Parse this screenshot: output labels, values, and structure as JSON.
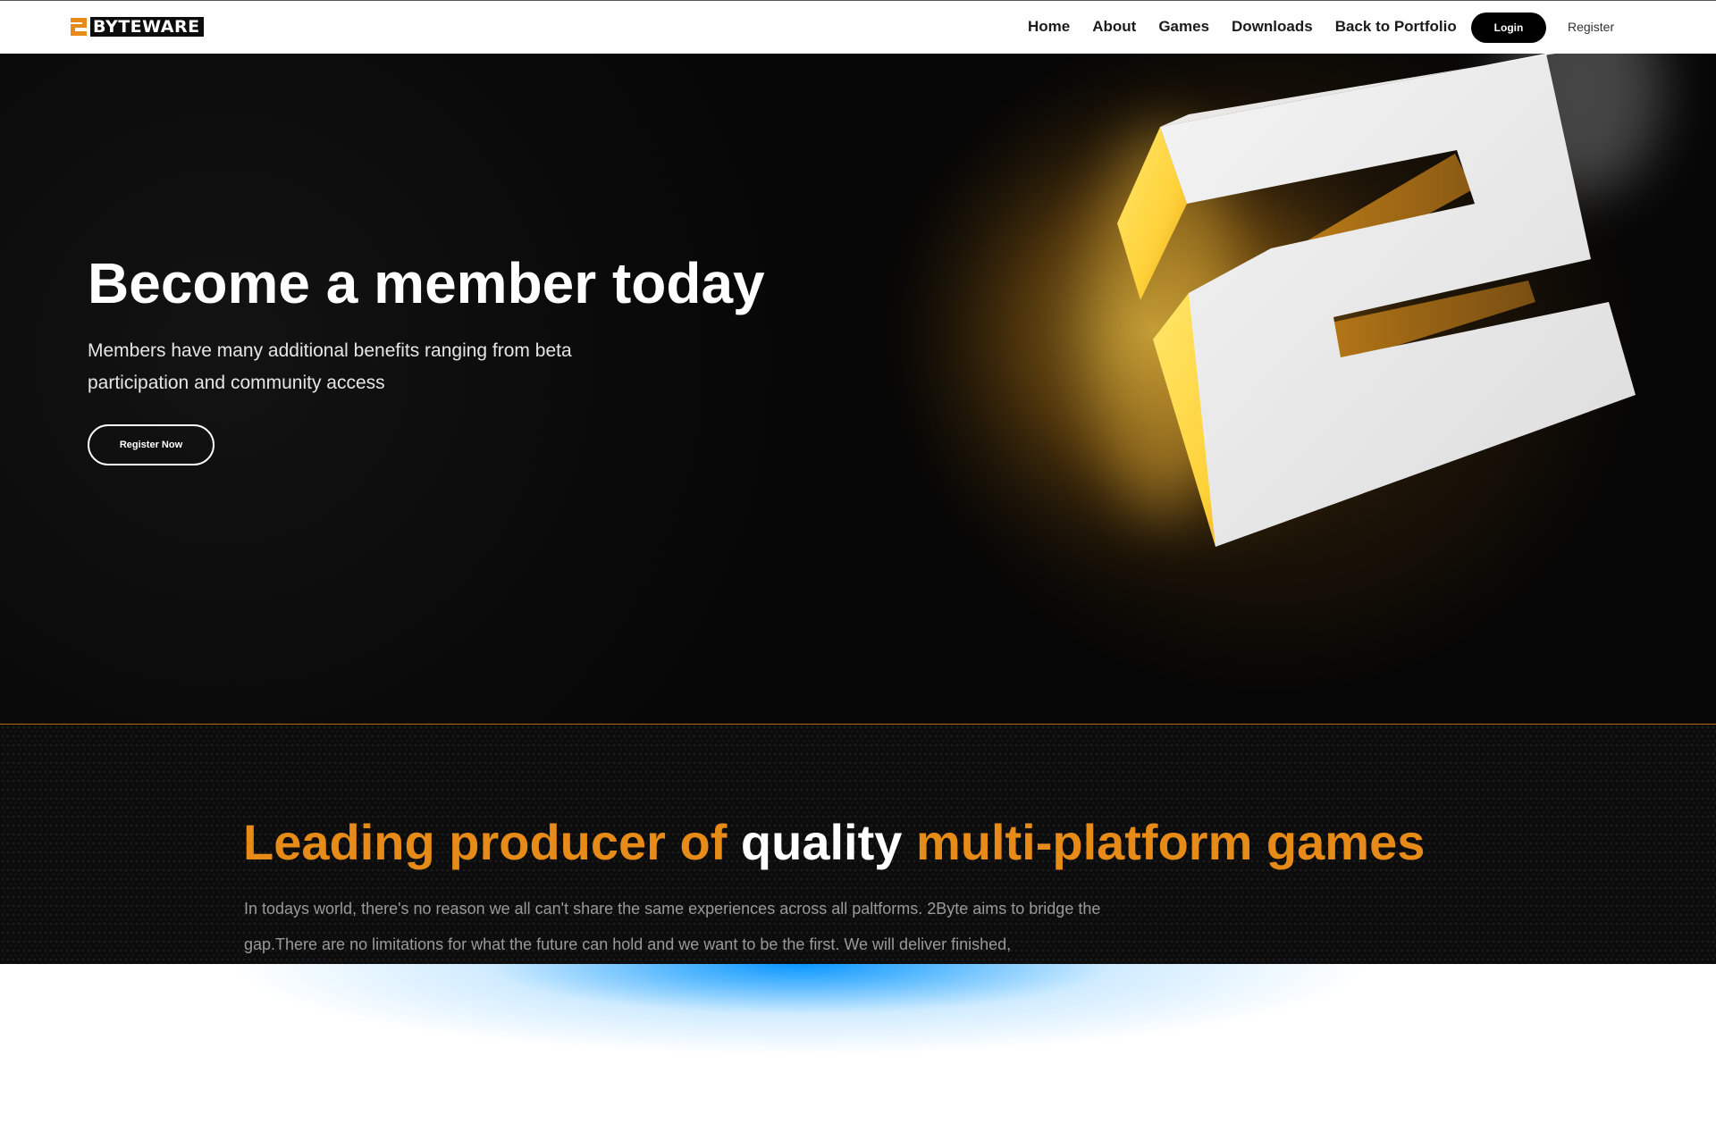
{
  "navbar": {
    "logo": {
      "mark": "2",
      "text": "BYTEWARE"
    },
    "links": [
      {
        "label": "Home"
      },
      {
        "label": "About"
      },
      {
        "label": "Games"
      },
      {
        "label": "Downloads"
      },
      {
        "label": "Back to Portfolio"
      }
    ],
    "login_label": "Login",
    "register_label": "Register"
  },
  "hero": {
    "title": "Become a member today",
    "subtitle": "Members have many additional benefits ranging from beta participation and community access",
    "button_label": "Register Now"
  },
  "leading": {
    "title_part1": "Leading producer of ",
    "title_part2": "quality",
    "title_part3": " multi-platform games",
    "body": "In todays world, there's no reason we all can't share the same experiences across all paltforms. 2Byte aims to bridge the gap.There are no limitations for what the future can hold and we want to be the first. We will deliver finished,"
  },
  "colors": {
    "accent_orange": "#e68a18",
    "glow_blue": "#0a96ff",
    "hero_background": "#080808",
    "nav_background": "#ffffff"
  },
  "icons": {
    "logo_mark": "2-logo-icon",
    "hero_art": "3d-2-logo-icon"
  }
}
